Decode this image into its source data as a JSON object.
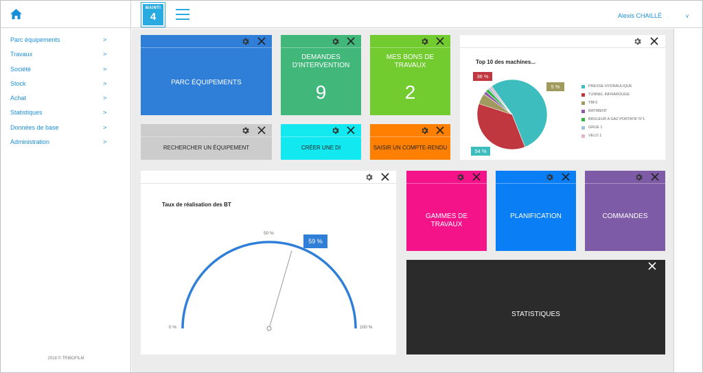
{
  "sidebar": {
    "items": [
      {
        "label": "Parc équipements",
        "chevron": ">"
      },
      {
        "label": "Travaux",
        "chevron": ">"
      },
      {
        "label": "Société",
        "chevron": ">"
      },
      {
        "label": "Stock",
        "chevron": ">"
      },
      {
        "label": "Achat",
        "chevron": ">"
      },
      {
        "label": "Statistiques",
        "chevron": ">"
      },
      {
        "label": "Données de base",
        "chevron": ">"
      },
      {
        "label": "Administration",
        "chevron": ">"
      }
    ],
    "copyright": "2018 © TRIBOFILM"
  },
  "header": {
    "logo_line1": "MAINTI",
    "logo_line2": "4",
    "user": "Alexis CHAILLÉ",
    "user_caret": "v"
  },
  "tiles": {
    "parc": {
      "label": "PARC ÉQUIPEMENTS",
      "color": "#2f7ed8"
    },
    "demandes": {
      "label": "DEMANDES D'INTERVENTION",
      "value": "9",
      "color": "#41b77a"
    },
    "bons": {
      "label": "MES BONS DE TRAVAUX",
      "value": "2",
      "color": "#72cc30"
    },
    "rechercher": {
      "label": "RECHERCHER UN ÉQUIPEMENT",
      "color": "#cccccc"
    },
    "creer": {
      "label": "CRÉER UNE DI",
      "color": "#11e8f0"
    },
    "saisir": {
      "label": "SAISIR UN COMPTE-RENDU",
      "color": "#ff7f00"
    },
    "gammes": {
      "label": "GAMMES DE TRAVAUX",
      "color": "#f5138a"
    },
    "planification": {
      "label": "PLANIFICATION",
      "color": "#0a7ef5"
    },
    "commandes": {
      "label": "COMMANDES",
      "color": "#7e5ba6"
    },
    "statistiques": {
      "label": "STATISTIQUES",
      "color": "#2b2b2b"
    }
  },
  "pie_panel": {
    "title": "Top 10 des machines...",
    "chart_data": {
      "type": "pie",
      "labels": [
        "PRESSE HYDRAULIQUE",
        "TUNNEL INFRAROUGE",
        "TBF2",
        "BATIMENT",
        "BRULEUR A GAZ PORTATIF N°1",
        "GRUE 1",
        "VELO 1"
      ],
      "values": [
        54,
        36,
        5,
        1.5,
        1.5,
        1,
        1
      ],
      "colors": [
        "#3dbdbd",
        "#c0373f",
        "#a09a5e",
        "#8e5ba8",
        "#35b43f",
        "#9ec3dd",
        "#e8b3c3"
      ],
      "data_labels": [
        "54 %",
        "36 %",
        "5 %"
      ]
    }
  },
  "gauge_panel": {
    "title": "Taux de réalisation des BT",
    "chart_data": {
      "type": "gauge",
      "value": 59,
      "min": 0,
      "max": 100,
      "value_label": "59 %",
      "tick_labels": [
        "0 %",
        "50 %",
        "100 %"
      ],
      "color": "#2f7ed8"
    }
  }
}
